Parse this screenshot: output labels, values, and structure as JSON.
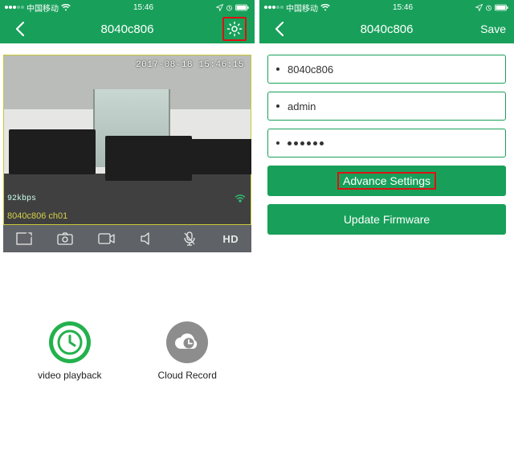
{
  "status": {
    "carrier": "中国移动",
    "time": "15:46"
  },
  "left": {
    "title": "8040c806",
    "video": {
      "timestamp": "2017-08-18 15:46:15",
      "bitrate": "92kbps",
      "channel": "8040c806 ch01"
    },
    "controls": {
      "hd": "HD"
    },
    "playback_label": "video playback",
    "cloud_label": "Cloud Record"
  },
  "right": {
    "title": "8040c806",
    "save": "Save",
    "fields": {
      "device": "8040c806",
      "user": "admin",
      "password": "••••••"
    },
    "advance": "Advance Settings",
    "update": "Update Firmware"
  }
}
